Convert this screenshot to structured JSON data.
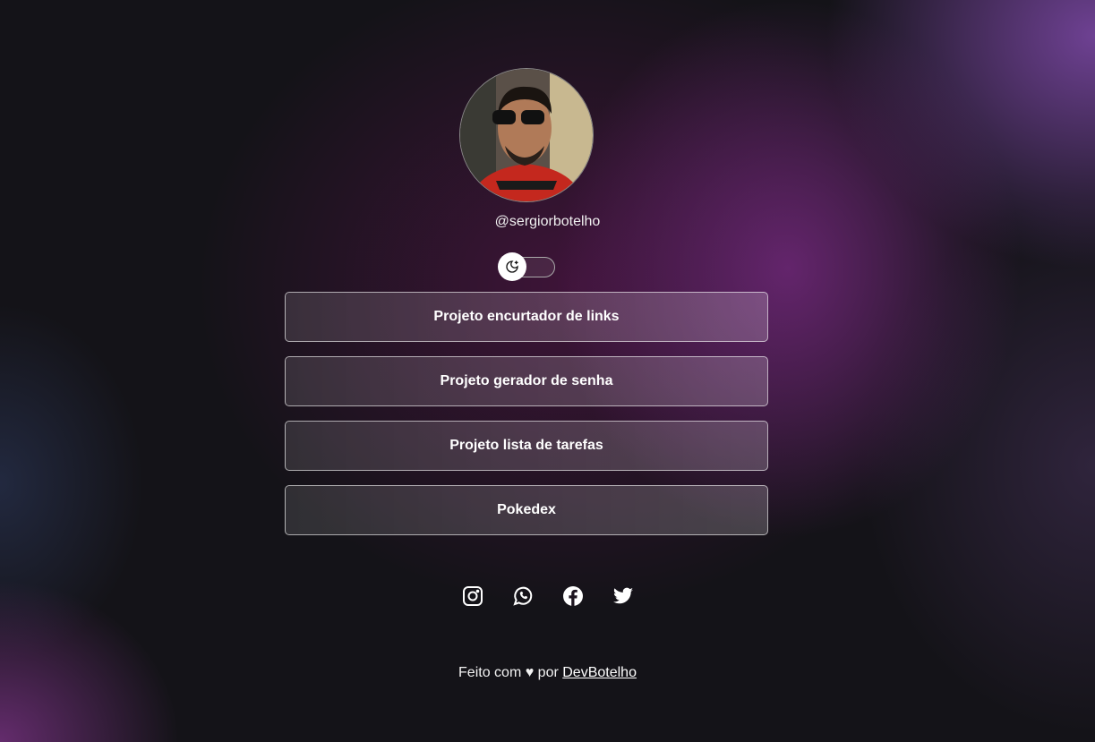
{
  "profile": {
    "handle": "@sergiorbotelho",
    "avatar_alt": "profile photo"
  },
  "theme_toggle": {
    "icon": "moon-stars-icon",
    "state": "dark"
  },
  "links": [
    {
      "label": "Projeto encurtador de links"
    },
    {
      "label": "Projeto gerador de senha"
    },
    {
      "label": "Projeto lista de tarefas"
    },
    {
      "label": "Pokedex"
    }
  ],
  "social": [
    {
      "name": "instagram",
      "icon": "instagram-icon"
    },
    {
      "name": "whatsapp",
      "icon": "whatsapp-icon"
    },
    {
      "name": "facebook",
      "icon": "facebook-icon"
    },
    {
      "name": "twitter",
      "icon": "twitter-icon"
    }
  ],
  "footer": {
    "prefix": "Feito com ♥ por",
    "link_label": "DevBotelho"
  }
}
